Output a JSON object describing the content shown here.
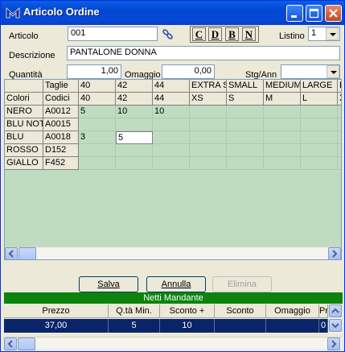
{
  "window": {
    "title": "Articolo Ordine"
  },
  "form": {
    "articolo_label": "Articolo",
    "articolo_value": "001",
    "format_buttons": [
      "C",
      "D",
      "B",
      "N"
    ],
    "listino_label": "Listino",
    "listino_value": "1",
    "descrizione_label": "Descrizione",
    "descrizione_value": "PANTALONE DONNA",
    "quantita_label": "Quantità",
    "quantita_value": "1,00",
    "omaggio_label": "Omaggio",
    "omaggio_value": "0,00",
    "stg_label": "Stg/Ann",
    "stg_value": ""
  },
  "grid": {
    "taglie_label": "Taglie",
    "colori_label": "Colori",
    "codici_label": "Codici",
    "sizes": [
      "40",
      "42",
      "44",
      "EXTRA SMALL",
      "SMALL",
      "MEDIUM",
      "LARGE",
      "E"
    ],
    "size_codes": [
      "40",
      "42",
      "44",
      "XS",
      "S",
      "M",
      "L",
      "X"
    ],
    "rows": [
      {
        "color": "NERO",
        "code": "A0012",
        "qty": [
          "5",
          "10",
          "10",
          "",
          "",
          "",
          "",
          ""
        ]
      },
      {
        "color": "BLU NOTTE",
        "code": "A0015",
        "qty": [
          "",
          "",
          "",
          "",
          "",
          "",
          "",
          ""
        ]
      },
      {
        "color": "BLU",
        "code": "A0018",
        "qty": [
          "3",
          "5",
          "",
          "",
          "",
          "",
          "",
          ""
        ]
      },
      {
        "color": "ROSSO",
        "code": "D152",
        "qty": [
          "",
          "",
          "",
          "",
          "",
          "",
          "",
          ""
        ]
      },
      {
        "color": "GIALLO",
        "code": "F452",
        "qty": [
          "",
          "",
          "",
          "",
          "",
          "",
          "",
          ""
        ]
      }
    ]
  },
  "buttons": {
    "salva": "Salva",
    "annulla": "Annulla",
    "elimina": "Elimina"
  },
  "netti": {
    "label": "Netti Mandante"
  },
  "prices": {
    "headers": [
      "Prezzo",
      "Q.tà Min.",
      "Sconto  +",
      "Sconto",
      "Omaggio",
      "Prezzo"
    ],
    "row": [
      "37,00",
      "5",
      "10",
      "",
      "",
      "0"
    ]
  },
  "colors": {
    "title_bar": "#0a5fe9",
    "grid_bg": "#c0dcc0",
    "netti_bar": "#0d830d",
    "selected_row": "#0a246a"
  }
}
